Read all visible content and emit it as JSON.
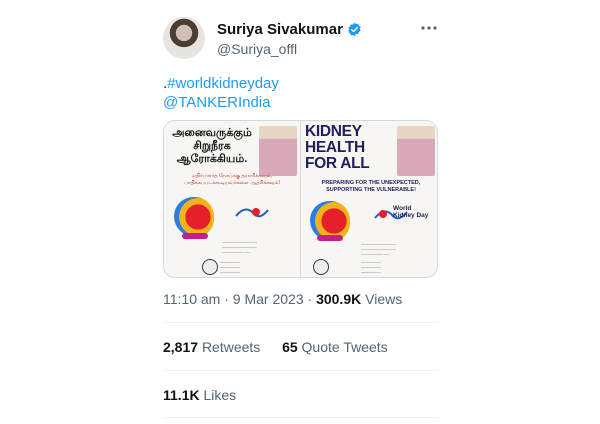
{
  "author": {
    "name": "Suriya Sivakumar",
    "handle": "@Suriya_offl"
  },
  "tweet": {
    "line1_prefix": ".",
    "hashtag": "#worldkidneyday",
    "mention": "@TANKERIndia"
  },
  "media": {
    "left_title": "அனைவருக்கும் சிறுநீரக ஆரோக்கியம்.",
    "left_sub": "எதிர்பாராத நோய்க்கு தயாரிக்கவும், பாதிக்கப்படக்கூடியவர்களை ஆதரிக்கவும்!",
    "right_title": "KIDNEY HEALTH FOR ALL",
    "right_sub": "PREPARING FOR THE UNEXPECTED, SUPPORTING THE VULNERABLE!",
    "wkd_label": "World Kidney Day"
  },
  "meta": {
    "time": "11:10 am",
    "sep": "·",
    "date": "9 Mar 2023",
    "sep2": "·",
    "views_count": "300.9K",
    "views_label": "Views"
  },
  "stats": {
    "retweets_count": "2,817",
    "retweets_label": "Retweets",
    "quotes_count": "65",
    "quotes_label": "Quote Tweets",
    "likes_count": "11.1K",
    "likes_label": "Likes"
  },
  "colors": {
    "link": "#1d9bf0",
    "verified": "#1d9bf0"
  }
}
